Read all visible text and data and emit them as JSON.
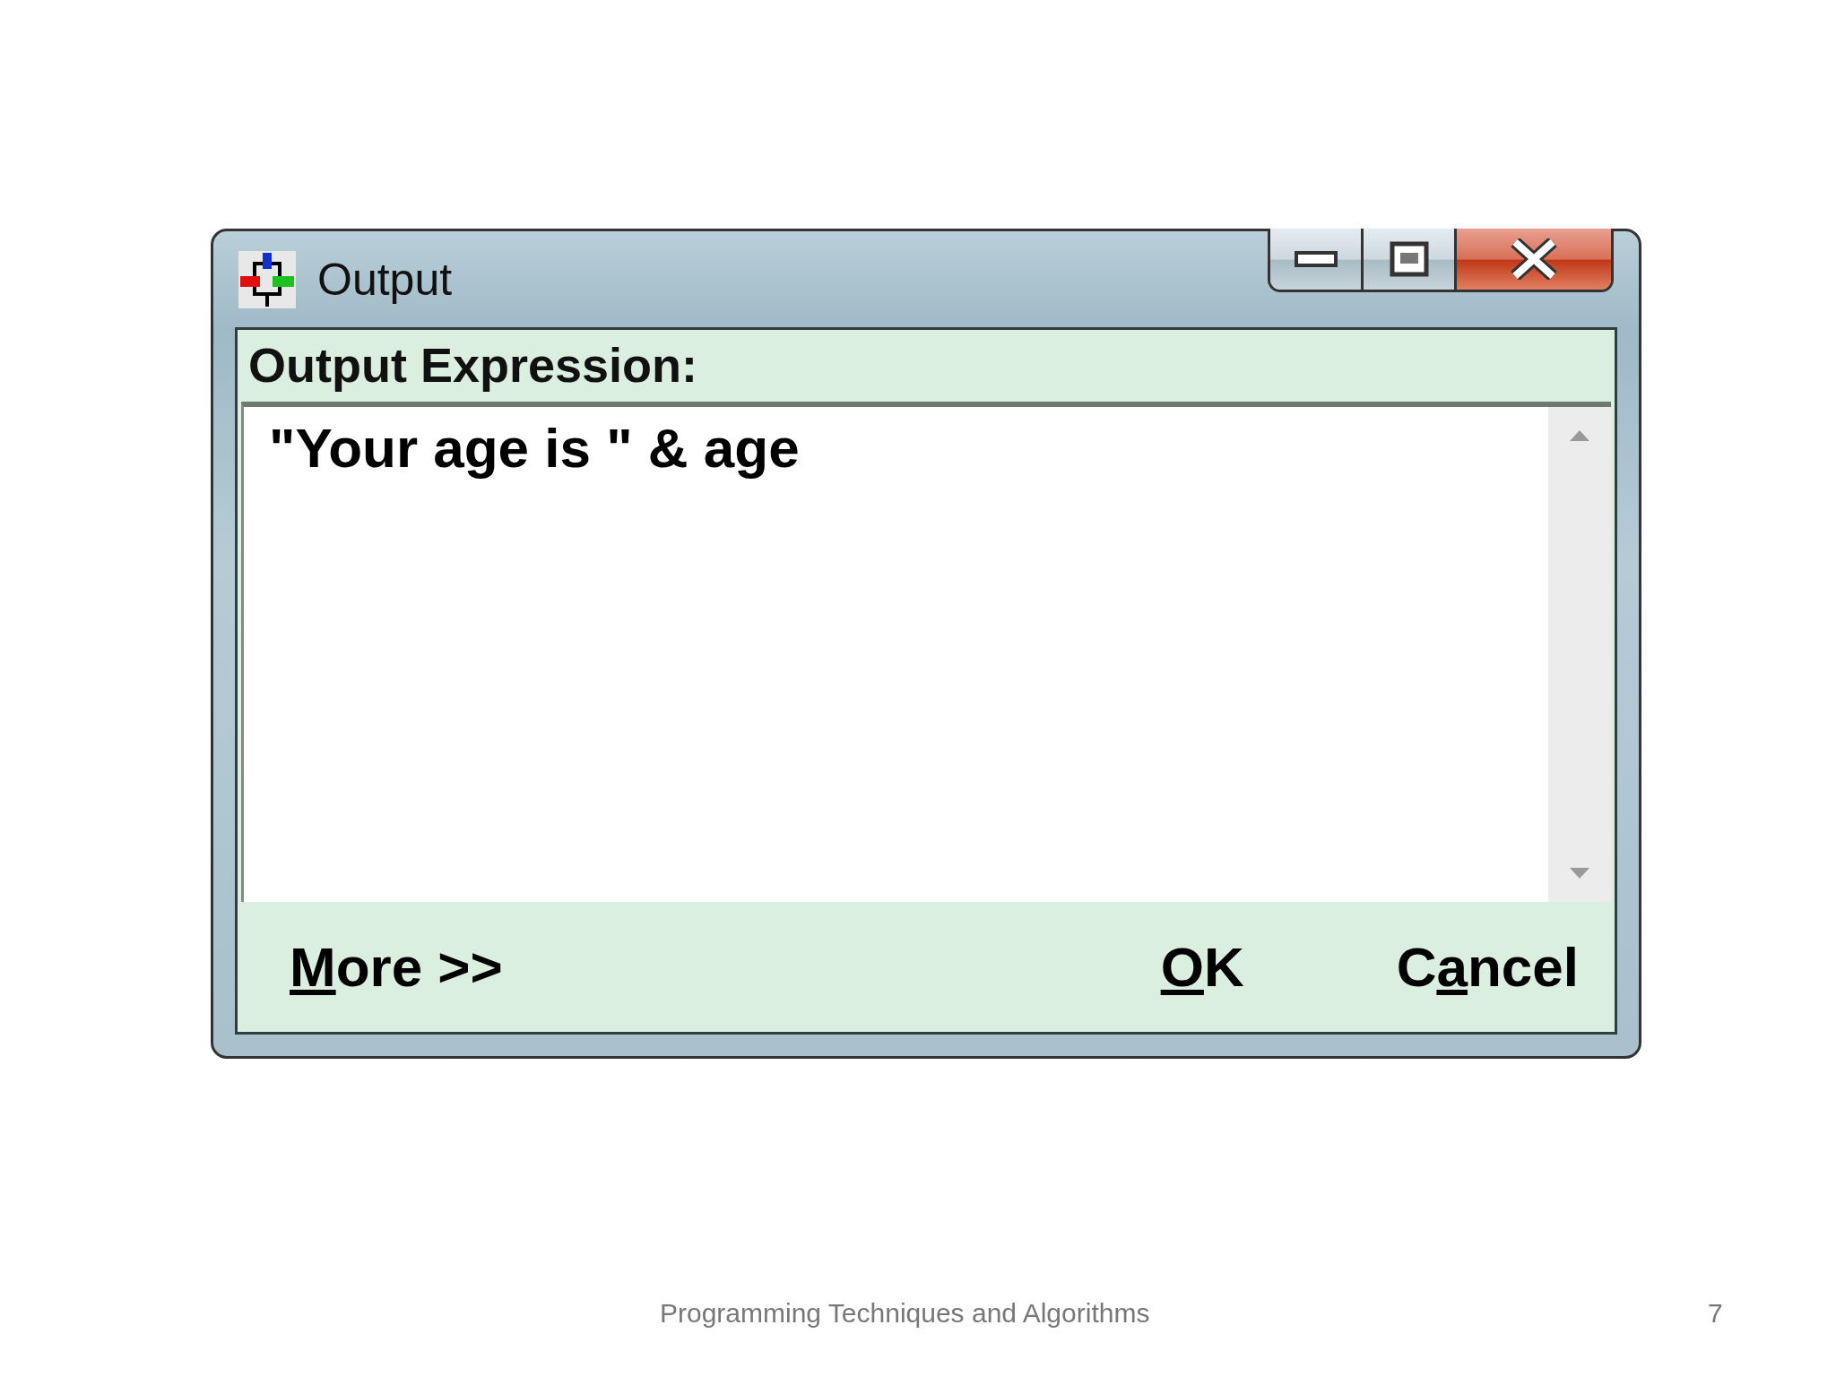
{
  "window": {
    "title": "Output"
  },
  "prompt": "Output Expression:",
  "expression": "\"Your age is \" & age",
  "buttons": [
    {
      "key": "M",
      "after": "ore >>"
    },
    {
      "key": "O",
      "after": "K"
    },
    {
      "before": "C",
      "key": "a",
      "after": "ncel"
    }
  ],
  "footer": {
    "title": "Programming Techniques and Algorithms",
    "page": "7"
  }
}
